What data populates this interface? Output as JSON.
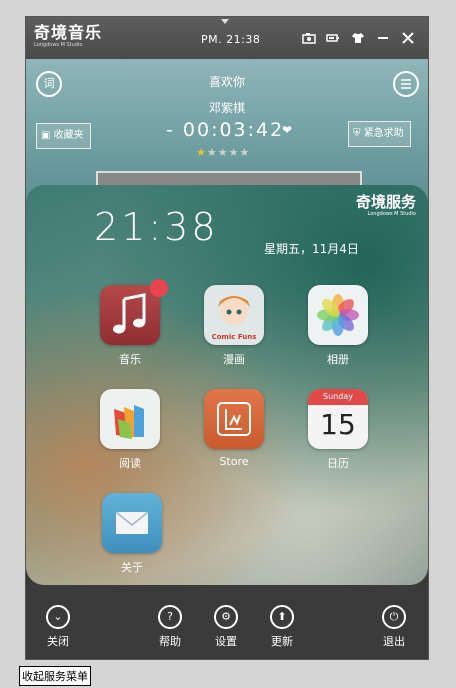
{
  "titlebar": {
    "app_name": "奇境音乐",
    "app_sub": "Longdows M Studio",
    "clock": "PM. 21:38",
    "icons": [
      "camera-icon",
      "battery-icon",
      "shirt-icon",
      "minimize-icon",
      "close-icon"
    ]
  },
  "player": {
    "lyrics_label": "词",
    "favorites_label": "收藏夹",
    "song_title": "喜欢你",
    "artist": "邓紫棋",
    "time": "- 00:03:42",
    "rating": 1,
    "rating_max": 5,
    "emergency_label": "紧急求助"
  },
  "service": {
    "clock": "21:38",
    "date": "星期五，11月4日",
    "logo_name": "奇境服务",
    "logo_sub": "Longdows M Studio",
    "apps": [
      {
        "label": "音乐",
        "color": "#a73c3c"
      },
      {
        "label": "漫画",
        "icon_text": "Comic Funs"
      },
      {
        "label": "相册"
      },
      {
        "label": "阅读"
      },
      {
        "label": "Store",
        "color": "#d96a3e"
      },
      {
        "label": "日历",
        "weekday": "Sunday",
        "day": "15"
      },
      {
        "label": "关于",
        "color": "#4a9fc8"
      }
    ]
  },
  "bottom": {
    "close": "关闭",
    "help": "帮助",
    "settings": "设置",
    "update": "更新",
    "exit": "退出"
  },
  "tooltip": "收起服务菜单"
}
